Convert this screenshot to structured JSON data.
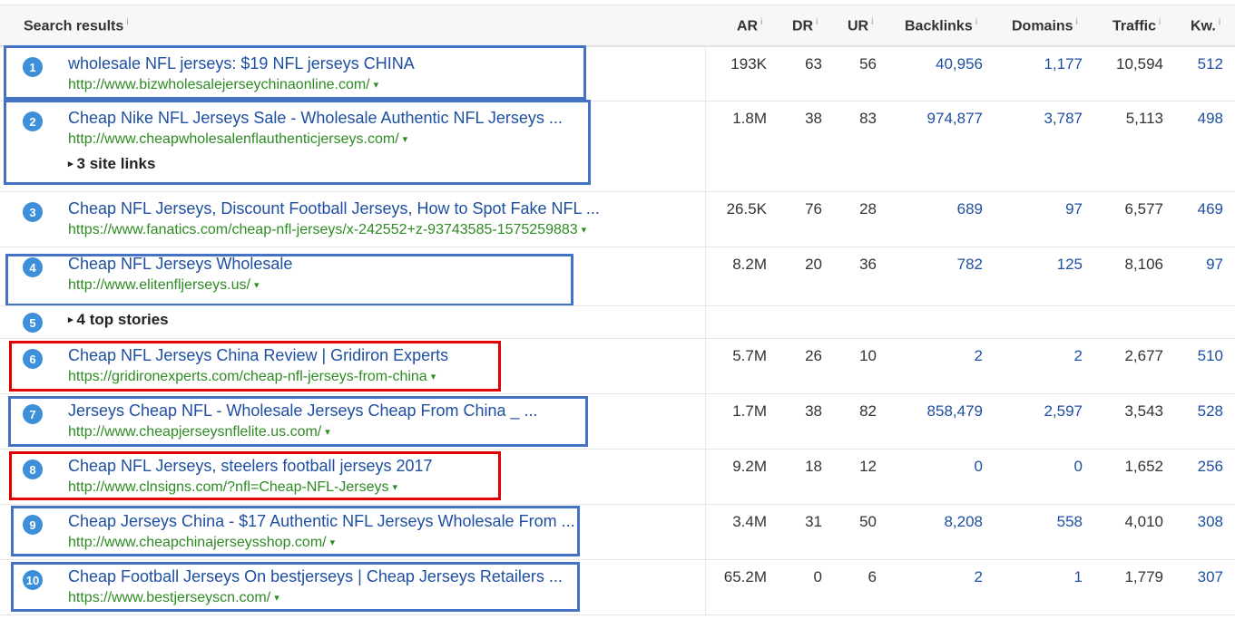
{
  "header": {
    "search_results": "Search results",
    "ar": "AR",
    "dr": "DR",
    "ur": "UR",
    "backlinks": "Backlinks",
    "domains": "Domains",
    "traffic": "Traffic",
    "kw": "Kw.",
    "info_mark": "i"
  },
  "caret": "▾",
  "expander": "▸",
  "results": [
    {
      "n": "1",
      "title": "wholesale NFL jerseys: $19 NFL jerseys CHINA",
      "url": "http://www.bizwholesalejerseychinaonline.com/",
      "ar": "193K",
      "dr": "63",
      "ur": "56",
      "backlinks": "40,956",
      "domains": "1,177",
      "traffic": "10,594",
      "kw": "512",
      "box": "blue"
    },
    {
      "n": "2",
      "title": "Cheap Nike NFL Jerseys Sale - Wholesale Authentic NFL Jerseys ...",
      "url": "http://www.cheapwholesalenflauthenticjerseys.com/",
      "extra": "3 site links",
      "ar": "1.8M",
      "dr": "38",
      "ur": "83",
      "backlinks": "974,877",
      "domains": "3,787",
      "traffic": "5,113",
      "kw": "498",
      "box": "blue"
    },
    {
      "n": "3",
      "title": "Cheap NFL Jerseys, Discount Football Jerseys, How to Spot Fake NFL ...",
      "url": "https://www.fanatics.com/cheap-nfl-jerseys/x-242552+z-93743585-1575259883",
      "ar": "26.5K",
      "dr": "76",
      "ur": "28",
      "backlinks": "689",
      "domains": "97",
      "traffic": "6,577",
      "kw": "469",
      "box": ""
    },
    {
      "n": "4",
      "title": "Cheap NFL Jerseys Wholesale",
      "url": "http://www.elitenfljerseys.us/",
      "ar": "8.2M",
      "dr": "20",
      "ur": "36",
      "backlinks": "782",
      "domains": "125",
      "traffic": "8,106",
      "kw": "97",
      "box": "blue"
    },
    {
      "n": "5",
      "extra": "4 top stories"
    },
    {
      "n": "6",
      "title": "Cheap NFL Jerseys China Review | Gridiron Experts",
      "url": "https://gridironexperts.com/cheap-nfl-jerseys-from-china",
      "ar": "5.7M",
      "dr": "26",
      "ur": "10",
      "backlinks": "2",
      "domains": "2",
      "traffic": "2,677",
      "kw": "510",
      "box": "red"
    },
    {
      "n": "7",
      "title": "Jerseys Cheap NFL - Wholesale Jerseys Cheap From China _ ...",
      "url": "http://www.cheapjerseysnflelite.us.com/",
      "ar": "1.7M",
      "dr": "38",
      "ur": "82",
      "backlinks": "858,479",
      "domains": "2,597",
      "traffic": "3,543",
      "kw": "528",
      "box": "blue"
    },
    {
      "n": "8",
      "title": "Cheap NFL Jerseys, steelers football jerseys 2017",
      "url": "http://www.clnsigns.com/?nfl=Cheap-NFL-Jerseys",
      "ar": "9.2M",
      "dr": "18",
      "ur": "12",
      "backlinks": "0",
      "domains": "0",
      "traffic": "1,652",
      "kw": "256",
      "box": "red"
    },
    {
      "n": "9",
      "title": "Cheap Jerseys China - $17 Authentic NFL Jerseys Wholesale From ...",
      "url": "http://www.cheapchinajerseysshop.com/",
      "ar": "3.4M",
      "dr": "31",
      "ur": "50",
      "backlinks": "8,208",
      "domains": "558",
      "traffic": "4,010",
      "kw": "308",
      "box": "blue"
    },
    {
      "n": "10",
      "title": "Cheap Football Jerseys On bestjerseys | Cheap Jerseys Retailers ...",
      "url": "https://www.bestjerseyscn.com/",
      "ar": "65.2M",
      "dr": "0",
      "ur": "6",
      "backlinks": "2",
      "domains": "1",
      "traffic": "1,779",
      "kw": "307",
      "box": "blue"
    }
  ],
  "colors": {
    "title": "#1f4fa0",
    "url": "#2e8b23",
    "badge": "#3d8fd9",
    "highlight_blue": "#4472c4",
    "highlight_red": "#e00000"
  }
}
